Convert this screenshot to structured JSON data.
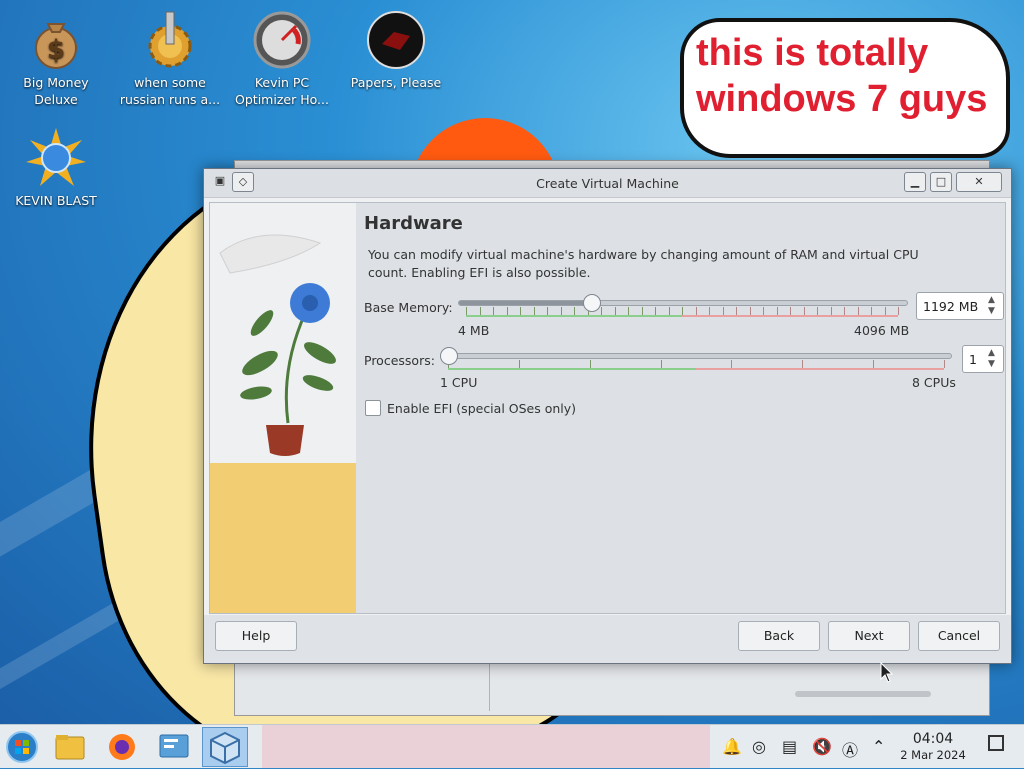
{
  "desktop": {
    "icons": [
      {
        "label_line1": "Big Money",
        "label_line2": "Deluxe"
      },
      {
        "label_line1": "when some",
        "label_line2": "russian runs a..."
      },
      {
        "label_line1": "Kevin PC",
        "label_line2": "Optimizer Ho..."
      },
      {
        "label_line1": "Papers, Please",
        "label_line2": ""
      },
      {
        "label_line1": "KEVIN BLAST",
        "label_line2": ""
      }
    ],
    "bubble_line1": "this is totally",
    "bubble_line2": "windows 7 guys"
  },
  "dialog": {
    "title": "Create Virtual Machine",
    "page_title": "Hardware",
    "description": "You can modify virtual machine's hardware by changing amount of RAM and virtual CPU count. Enabling EFI is also possible.",
    "memory": {
      "label": "Base Memory:",
      "min_label": "4 MB",
      "max_label": "4096 MB",
      "value": "1192 MB",
      "fraction": 0.29
    },
    "processors": {
      "label": "Processors:",
      "min_label": "1 CPU",
      "max_label": "8 CPUs",
      "value": "1",
      "fraction": 0
    },
    "efi_label": "Enable EFI (special OSes only)",
    "efi_checked": false,
    "buttons": {
      "help": "Help",
      "back": "Back",
      "next": "Next",
      "cancel": "Cancel"
    }
  },
  "taskbar": {
    "time": "04:04",
    "date": "2 Mar 2024",
    "accent": "#2e8bd0"
  }
}
